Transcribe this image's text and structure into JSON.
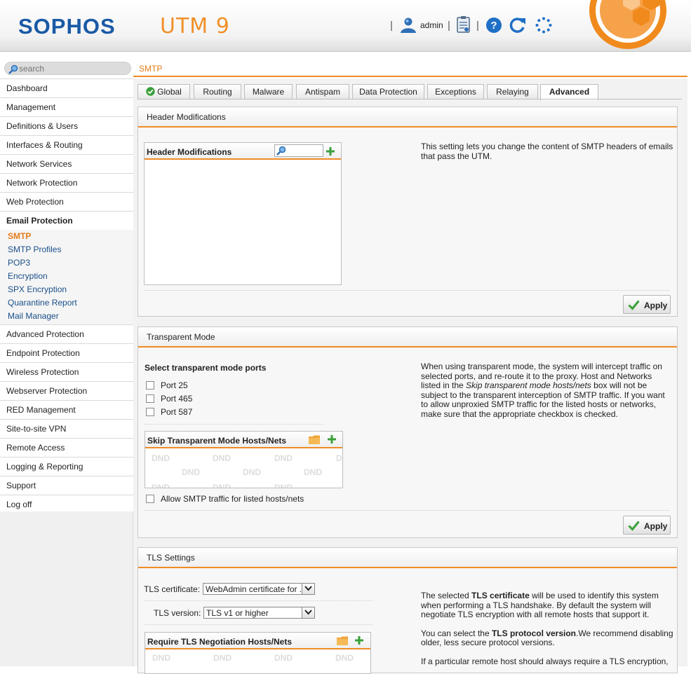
{
  "header": {
    "logo": "SOPHOS",
    "product": "UTM 9",
    "separator": "|",
    "user": "admin",
    "icons": [
      "user-icon",
      "clipboard-icon",
      "help-icon",
      "reload-icon",
      "activity-spinner-icon",
      "sophos-mark-icon"
    ]
  },
  "sidebar": {
    "search_placeholder": "search",
    "items": [
      {
        "label": "Dashboard"
      },
      {
        "label": "Management"
      },
      {
        "label": "Definitions & Users"
      },
      {
        "label": "Interfaces & Routing"
      },
      {
        "label": "Network Services"
      },
      {
        "label": "Network Protection"
      },
      {
        "label": "Web Protection"
      },
      {
        "label": "Email Protection"
      },
      {
        "label": "Advanced Protection"
      },
      {
        "label": "Endpoint Protection"
      },
      {
        "label": "Wireless Protection"
      },
      {
        "label": "Webserver Protection"
      },
      {
        "label": "RED Management"
      },
      {
        "label": "Site-to-site VPN"
      },
      {
        "label": "Remote Access"
      },
      {
        "label": "Logging & Reporting"
      },
      {
        "label": "Support"
      },
      {
        "label": "Log off"
      }
    ],
    "email_subitems": [
      {
        "label": "SMTP"
      },
      {
        "label": "SMTP Profiles"
      },
      {
        "label": "POP3"
      },
      {
        "label": "Encryption"
      },
      {
        "label": "SPX Encryption"
      },
      {
        "label": "Quarantine Report"
      },
      {
        "label": "Mail Manager"
      }
    ]
  },
  "page": {
    "title": "SMTP",
    "tabs": [
      "Global",
      "Routing",
      "Malware",
      "Antispam",
      "Data Protection",
      "Exceptions",
      "Relaying",
      "Advanced"
    ],
    "active_tab": "Advanced"
  },
  "header_mod": {
    "title": "Header Modifications",
    "list_title": "Header Modifications",
    "description": "This setting lets you change the content of SMTP headers of emails that pass the UTM.",
    "apply": "Apply"
  },
  "transparent": {
    "title": "Transparent Mode",
    "ports_label": "Select transparent mode ports",
    "ports": [
      "Port 25",
      "Port 465",
      "Port 587"
    ],
    "skip_list_title": "Skip Transparent Mode Hosts/Nets",
    "dnd": "DND",
    "allow_label": "Allow SMTP traffic for listed hosts/nets",
    "desc_1": "When using transparent mode, the system will intercept traffic on selected ports, and re-route it to the proxy. Host and Networks listed in the ",
    "desc_em": "Skip transparent mode hosts/nets",
    "desc_2": " box will not be subject to the transparent interception of SMTP traffic. If you want to allow unproxied SMTP traffic for the listed hosts or networks, make sure that the appropriate checkbox is checked.",
    "apply": "Apply"
  },
  "tls": {
    "title": "TLS Settings",
    "cert_label": "TLS certificate:",
    "cert_value": "WebAdmin certificate for ...",
    "version_label": "TLS version:",
    "version_value": "TLS v1 or higher",
    "require_list_title": "Require TLS Negotiation Hosts/Nets",
    "desc_p1_a": "The selected ",
    "desc_p1_b": "TLS certificate",
    "desc_p1_c": " will be used to identify this system when performing a TLS handshake. By default the system will negotiate TLS encryption with all remote hosts that support it.",
    "desc_p2_a": "You can select the ",
    "desc_p2_b": "TLS protocol version",
    "desc_p2_c": ".We recommend disabling older, less secure protocol versions.",
    "desc_p3": "If a particular remote host should always require a TLS encryption,"
  },
  "colors": {
    "brand_blue": "#1a5aa6",
    "accent_orange": "#ef8b26",
    "link_blue": "#1a4f8a",
    "ok_green": "#3aa03a"
  }
}
